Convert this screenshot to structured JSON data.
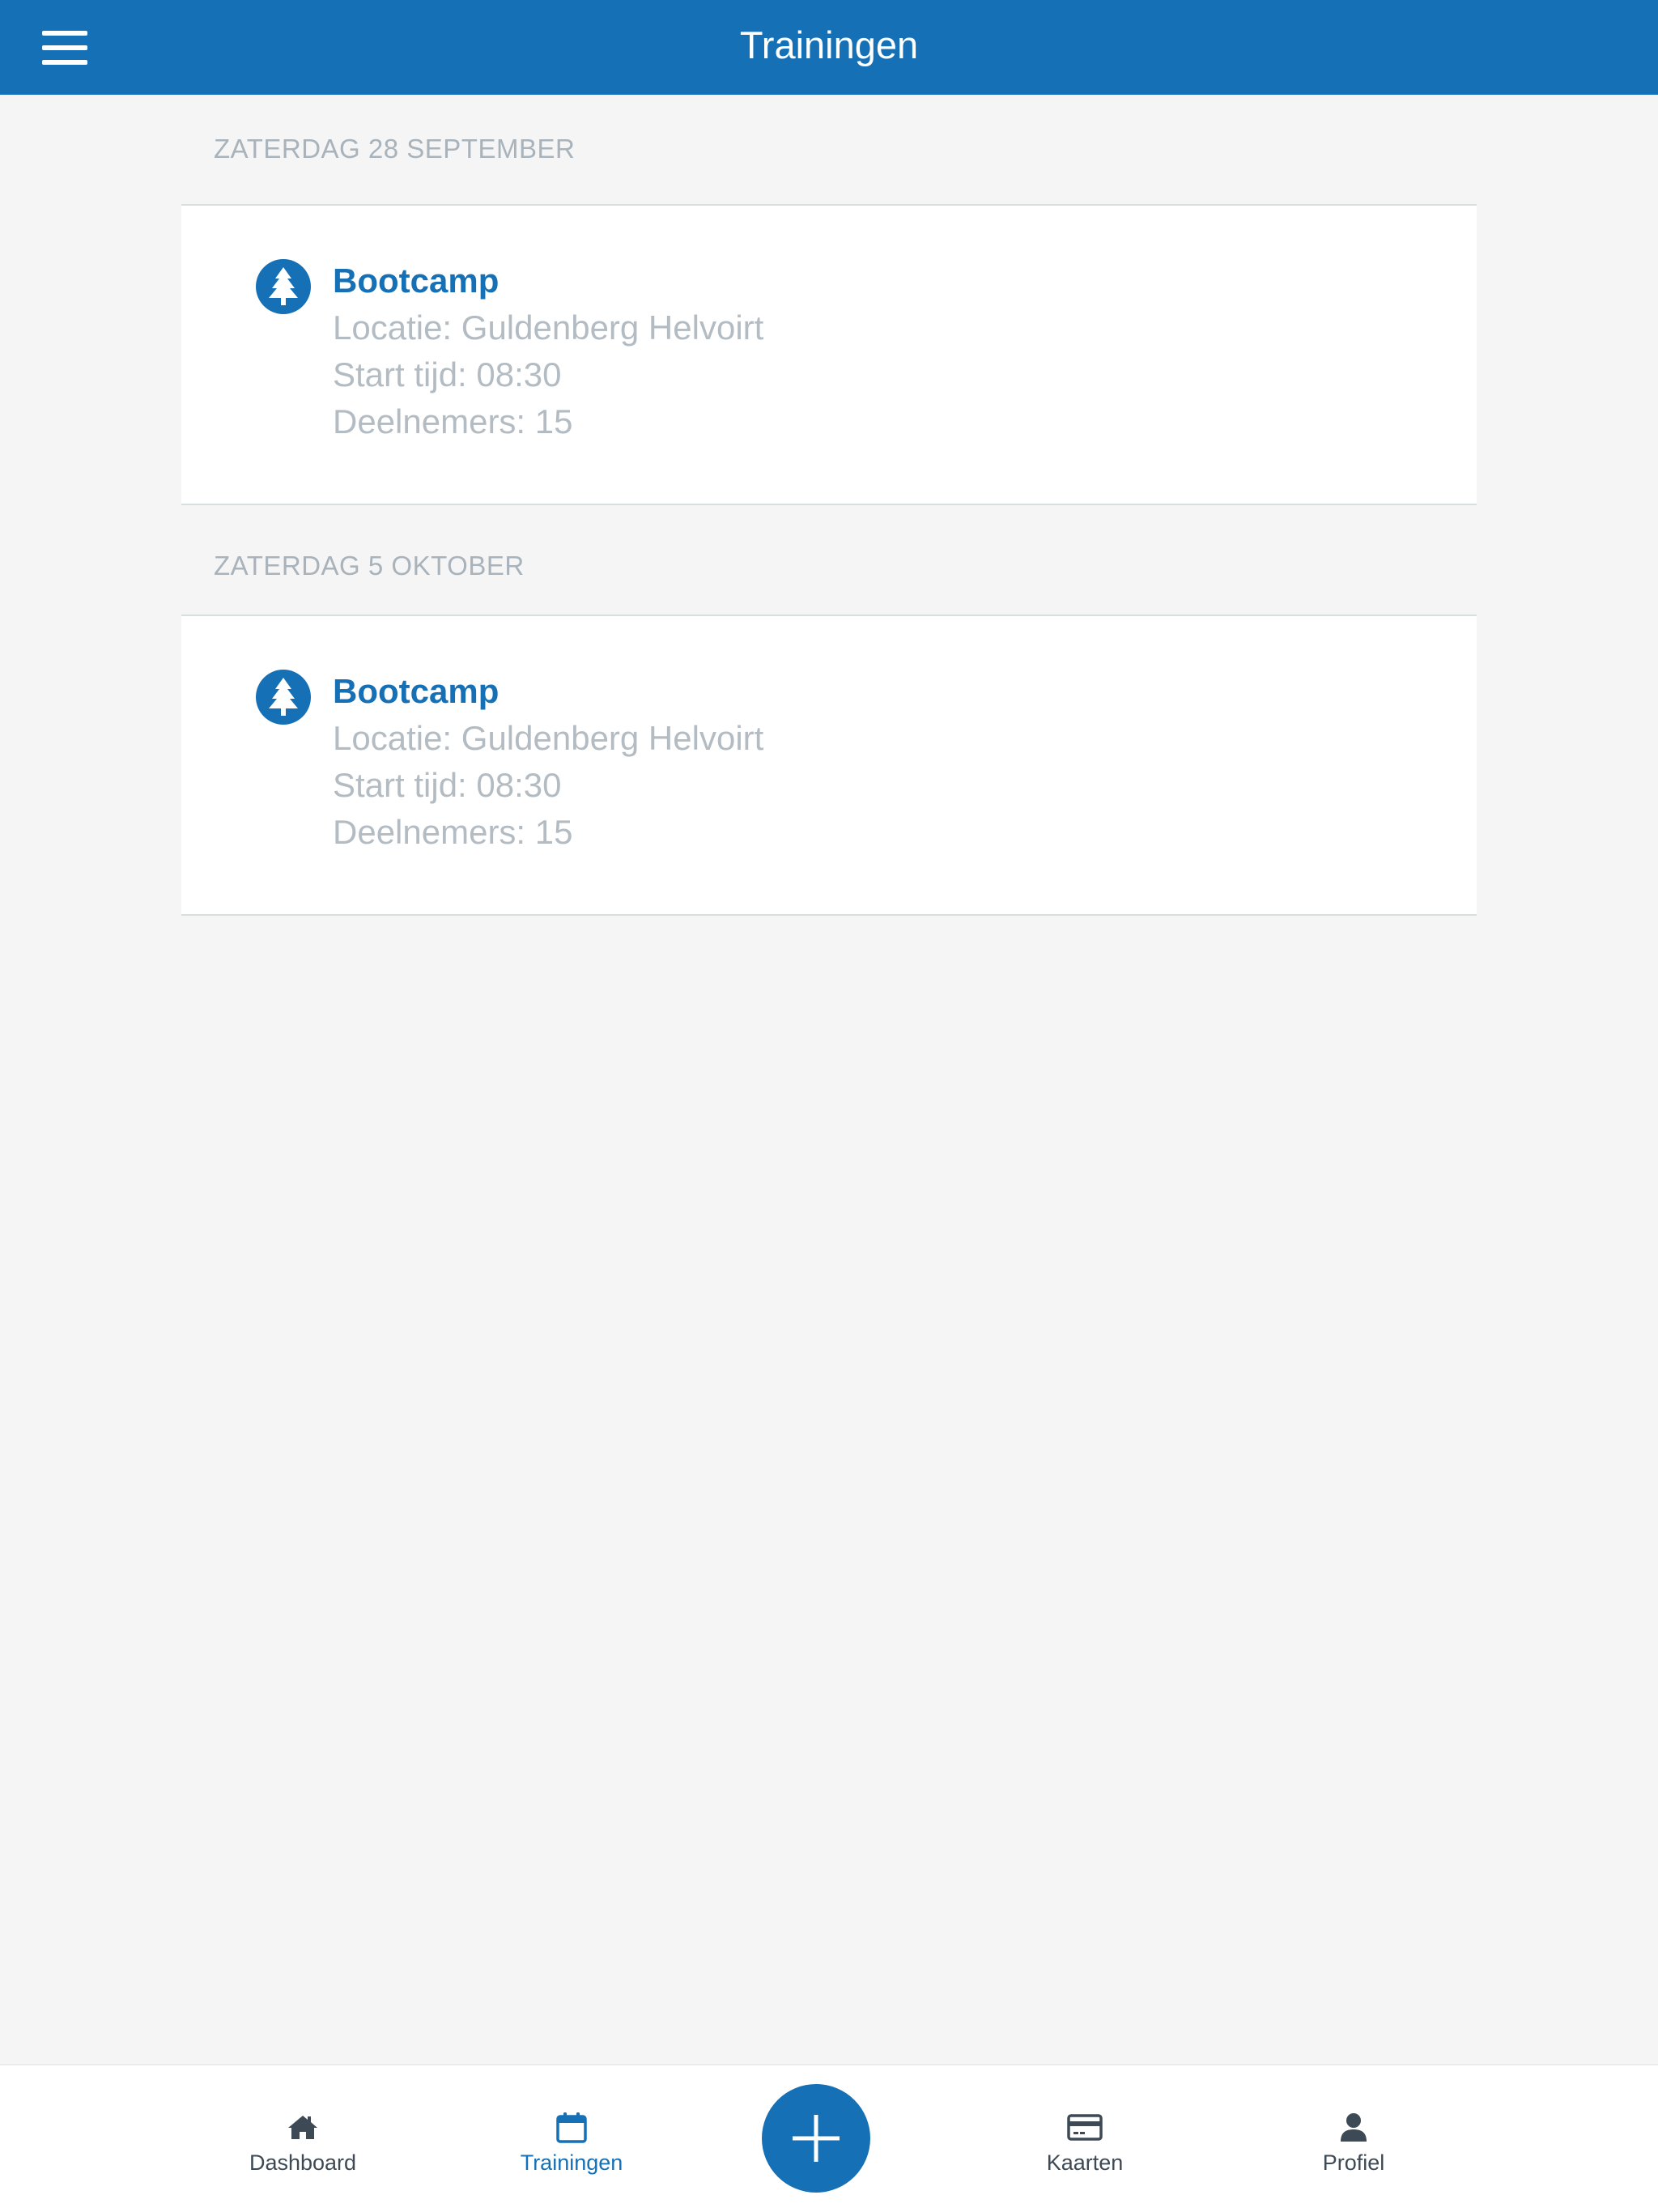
{
  "header": {
    "title": "Trainingen",
    "menu_icon": "hamburger-menu-icon"
  },
  "sections": [
    {
      "date": "ZATERDAG 28 SEPTEMBER",
      "items": [
        {
          "icon": "tree-icon",
          "title": "Bootcamp",
          "location": "Locatie: Guldenberg Helvoirt",
          "start": "Start tijd: 08:30",
          "participants": "Deelnemers: 15"
        }
      ]
    },
    {
      "date": "ZATERDAG 5 OKTOBER",
      "items": [
        {
          "icon": "tree-icon",
          "title": "Bootcamp",
          "location": "Locatie: Guldenberg Helvoirt",
          "start": "Start tijd: 08:30",
          "participants": "Deelnemers: 15"
        }
      ]
    }
  ],
  "tabbar": {
    "tabs": [
      {
        "label": "Dashboard",
        "icon": "home-icon",
        "active": false
      },
      {
        "label": "Trainingen",
        "icon": "calendar-icon",
        "active": true
      },
      {
        "label": "Kaarten",
        "icon": "credit-card-icon",
        "active": false
      },
      {
        "label": "Profiel",
        "icon": "user-icon",
        "active": false
      }
    ],
    "fab_icon": "plus-icon"
  },
  "colors": {
    "primary": "#1670b6",
    "background": "#f5f5f5",
    "muted_text": "#b4bcc3",
    "section_header": "#a9b3bb",
    "tab_label": "#3d4a55"
  }
}
